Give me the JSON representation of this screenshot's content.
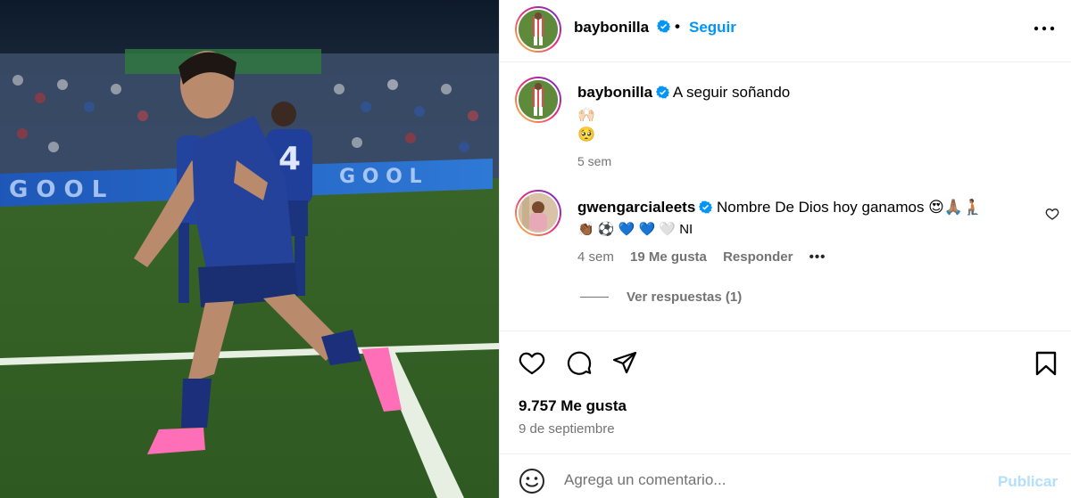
{
  "post": {
    "username": "baybonilla",
    "follow_label": "Seguir",
    "separator": "•",
    "image_alt": "Jugador con uniforme azul celebrando en la cancha"
  },
  "caption": {
    "username": "baybonilla",
    "text": "A seguir soñando",
    "emoji_line_1": "🙌🏻",
    "emoji_line_2": "🥺",
    "time": "5 sem"
  },
  "comment": {
    "username": "gwengarcialeets",
    "text": "Nombre De Dios hoy ganamos 😍🙏🏽🧎🏽",
    "emojis": "👏🏾 ⚽ 💙 💙 🤍 NI",
    "time": "4 sem",
    "likes": "19 Me gusta",
    "reply_label": "Responder",
    "more": "•••",
    "view_replies": "Ver respuestas (1)"
  },
  "actions": {
    "like_icon": "heart-icon",
    "comment_icon": "comment-icon",
    "share_icon": "share-icon",
    "save_icon": "bookmark-icon",
    "likes_count": "9.757 Me gusta",
    "date": "9 de septiembre"
  },
  "comment_box": {
    "placeholder": "Agrega un comentario...",
    "value": "",
    "publish_label": "Publicar"
  },
  "colors": {
    "link": "#0095f6",
    "publish_disabled": "#b2dffc",
    "muted": "#737373"
  }
}
